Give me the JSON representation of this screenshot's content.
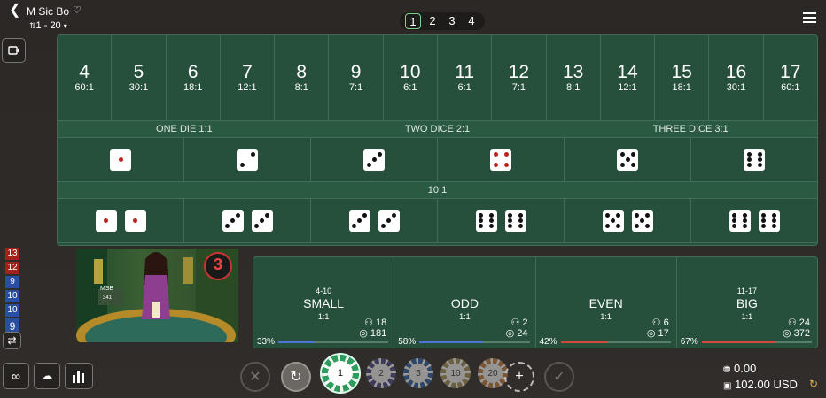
{
  "header": {
    "back_icon": "chevron-left-icon",
    "title": "M Sic Bo",
    "limits": "1 - 20",
    "tabs": [
      "1",
      "2",
      "3",
      "4"
    ],
    "active_tab": 0
  },
  "totals": [
    {
      "n": "4",
      "p": "60:1"
    },
    {
      "n": "5",
      "p": "30:1"
    },
    {
      "n": "6",
      "p": "18:1"
    },
    {
      "n": "7",
      "p": "12:1"
    },
    {
      "n": "8",
      "p": "8:1"
    },
    {
      "n": "9",
      "p": "7:1"
    },
    {
      "n": "10",
      "p": "6:1"
    },
    {
      "n": "11",
      "p": "6:1"
    },
    {
      "n": "12",
      "p": "7:1"
    },
    {
      "n": "13",
      "p": "8:1"
    },
    {
      "n": "14",
      "p": "12:1"
    },
    {
      "n": "15",
      "p": "18:1"
    },
    {
      "n": "16",
      "p": "30:1"
    },
    {
      "n": "17",
      "p": "60:1"
    }
  ],
  "single_headers": {
    "one": "ONE DIE 1:1",
    "two": "TWO DICE 2:1",
    "three": "THREE DICE 3:1"
  },
  "combo_header": "10:1",
  "single_dice": [
    1,
    2,
    3,
    4,
    5,
    6
  ],
  "combo_dice": [
    [
      1,
      1
    ],
    [
      3,
      3
    ],
    [
      3,
      3
    ],
    [
      6,
      6
    ],
    [
      5,
      5
    ],
    [
      6,
      6
    ]
  ],
  "history": [
    {
      "v": "13",
      "c": "r"
    },
    {
      "v": "12",
      "c": "r"
    },
    {
      "v": "9",
      "c": "b"
    },
    {
      "v": "10",
      "c": "b"
    },
    {
      "v": "10",
      "c": "b"
    },
    {
      "v": "9",
      "c": "b"
    }
  ],
  "video": {
    "timer": "3",
    "logo": "MSB",
    "placard": "341"
  },
  "side_bets": [
    {
      "range": "4-10",
      "name": "SMALL",
      "odds": "1:1",
      "players": "18",
      "amount": "181",
      "pct": "33%",
      "pct_val": 0.33,
      "color": "#4b76d6"
    },
    {
      "range": "",
      "name": "ODD",
      "odds": "1:1",
      "players": "2",
      "amount": "24",
      "pct": "58%",
      "pct_val": 0.58,
      "color": "#4b76d6"
    },
    {
      "range": "",
      "name": "EVEN",
      "odds": "1:1",
      "players": "6",
      "amount": "17",
      "pct": "42%",
      "pct_val": 0.42,
      "color": "#d24a3c"
    },
    {
      "range": "11-17",
      "name": "BIG",
      "odds": "1:1",
      "players": "24",
      "amount": "372",
      "pct": "67%",
      "pct_val": 0.67,
      "color": "#d24a3c"
    }
  ],
  "chips": [
    {
      "v": "1",
      "color": "#2e9c5c",
      "active": true
    },
    {
      "v": "2",
      "color": "#4a4580",
      "active": false
    },
    {
      "v": "5",
      "color": "#2f5d9c",
      "active": false
    },
    {
      "v": "10",
      "color": "#9c8a55",
      "active": false
    },
    {
      "v": "20",
      "color": "#b87840",
      "active": false
    }
  ],
  "balance": {
    "bet": "0.00",
    "total": "102.00 USD"
  }
}
